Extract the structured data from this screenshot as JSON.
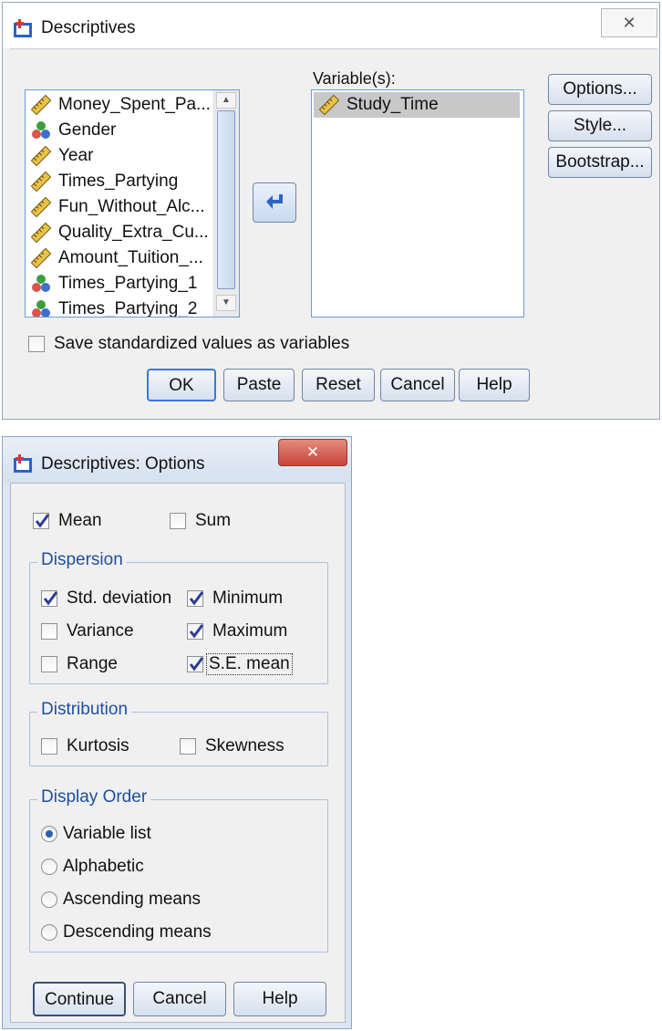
{
  "descriptives": {
    "title": "Descriptives",
    "close_glyph": "✕",
    "source_list": [
      {
        "label": "Money_Spent_Pa...",
        "icon": "scale-icon"
      },
      {
        "label": "Gender",
        "icon": "nominal-icon"
      },
      {
        "label": "Year",
        "icon": "scale-icon"
      },
      {
        "label": "Times_Partying",
        "icon": "scale-icon"
      },
      {
        "label": "Fun_Without_Alc...",
        "icon": "scale-icon"
      },
      {
        "label": "Quality_Extra_Cu...",
        "icon": "scale-icon"
      },
      {
        "label": "Amount_Tuition_...",
        "icon": "scale-icon"
      },
      {
        "label": "Times_Partying_1",
        "icon": "nominal-icon"
      },
      {
        "label": "Times_Partying_2",
        "icon": "nominal-icon"
      }
    ],
    "variables_label": "Variable(s):",
    "target_list": [
      {
        "label": "Study_Time",
        "icon": "scale-icon"
      }
    ],
    "buttons_right": {
      "options": "Options...",
      "style": "Style...",
      "bootstrap": "Bootstrap..."
    },
    "save_standardized": {
      "label": "Save standardized values as variables",
      "checked": false
    },
    "buttons_bottom": {
      "ok": "OK",
      "paste": "Paste",
      "reset": "Reset",
      "cancel": "Cancel",
      "help": "Help"
    }
  },
  "options": {
    "title": "Descriptives: Options",
    "close_glyph": "✕",
    "mean": {
      "label": "Mean",
      "checked": true
    },
    "sum": {
      "label": "Sum",
      "checked": false
    },
    "dispersion": {
      "legend": "Dispersion",
      "std_deviation": {
        "label": "Std. deviation",
        "checked": true
      },
      "minimum": {
        "label": "Minimum",
        "checked": true
      },
      "variance": {
        "label": "Variance",
        "checked": false
      },
      "maximum": {
        "label": "Maximum",
        "checked": true
      },
      "range": {
        "label": "Range",
        "checked": false
      },
      "se_mean": {
        "label": "S.E. mean",
        "checked": true
      }
    },
    "distribution": {
      "legend": "Distribution",
      "kurtosis": {
        "label": "Kurtosis",
        "checked": false
      },
      "skewness": {
        "label": "Skewness",
        "checked": false
      }
    },
    "display_order": {
      "legend": "Display Order",
      "selected": "Variable list",
      "items": [
        "Variable list",
        "Alphabetic",
        "Ascending means",
        "Descending means"
      ]
    },
    "buttons": {
      "continue": "Continue",
      "cancel": "Cancel",
      "help": "Help"
    }
  },
  "colors": {
    "accent_blue": "#2c5fb7",
    "selected_row": "#c8c8c8",
    "close_red": "#c9453a"
  }
}
